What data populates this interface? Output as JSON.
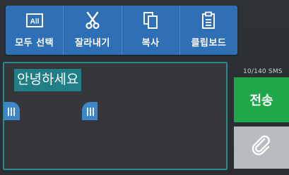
{
  "toolbar": {
    "items": [
      {
        "label": "모두 선택",
        "icon": "select-all-icon",
        "icon_text": "All"
      },
      {
        "label": "잘라내기",
        "icon": "scissors-icon"
      },
      {
        "label": "복사",
        "icon": "copy-icon"
      },
      {
        "label": "클립보드",
        "icon": "clipboard-icon"
      }
    ],
    "background": "#2f6fb5"
  },
  "composer": {
    "selected_text": "안녕하세요",
    "selection_color": "#1f7e86",
    "handle_color": "#3d86c8",
    "border_color": "#2a8a8e"
  },
  "counter": {
    "text": "10/140 SMS"
  },
  "send": {
    "label": "전송",
    "color": "#1fa84a"
  },
  "attach": {
    "icon": "paperclip-icon"
  }
}
